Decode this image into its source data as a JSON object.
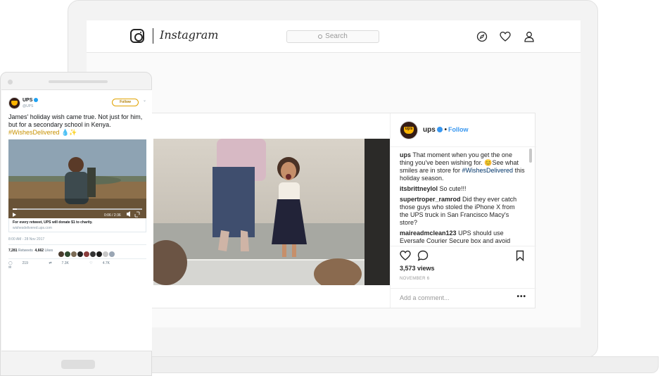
{
  "instagram": {
    "wordmark": "Instagram",
    "search_placeholder": "Search",
    "post": {
      "username": "ups",
      "follow_label": "Follow",
      "comments": [
        {
          "user": "ups",
          "parts": [
            "That moment when you get the one thing you've been wishing for. 😊See what smiles are in store for ",
            "#WishesDelivered",
            " this holiday season."
          ]
        },
        {
          "user": "itsbrittneylol",
          "text": "So cute!!!"
        },
        {
          "user": "supertroper_ramrod",
          "text": "Did they ever catch those guys who stoled the iPhone X from the UPS truck in San Francisco Macy's store?"
        },
        {
          "user": "maireadmclean123",
          "text": "UPS should use Eversafe Courier Secure box and avoid"
        }
      ],
      "views": "3,573 views",
      "date": "NOVEMBER 6",
      "comment_placeholder": "Add a comment...",
      "more_label": "•••"
    }
  },
  "twitter": {
    "name": "UPS",
    "handle": "@UPS",
    "follow_label": "Follow",
    "tweet_text": "James' holiday wish came true. Not just for him, but for a secondary school in Kenya. ",
    "hashtag": "#WishesDelivered",
    "emoji": "💧✨",
    "video_time": "0:06 / 2:36",
    "card_title": "For every retweet, UPS will donate $1 to charity.",
    "card_url": "wishesdelivered.ups.com",
    "timestamp": "8:00 AM - 28 Nov 2017",
    "retweets_count": "7,281",
    "retweets_label": "Retweets",
    "likes_count": "4,662",
    "likes_label": "Likes",
    "reply_count": "219",
    "retweet_count_short": "7.3K",
    "like_count_short": "4.7K"
  },
  "colors": {
    "ups_brown": "#351c15",
    "ups_gold": "#ffb500",
    "ig_blue": "#3897f0"
  }
}
